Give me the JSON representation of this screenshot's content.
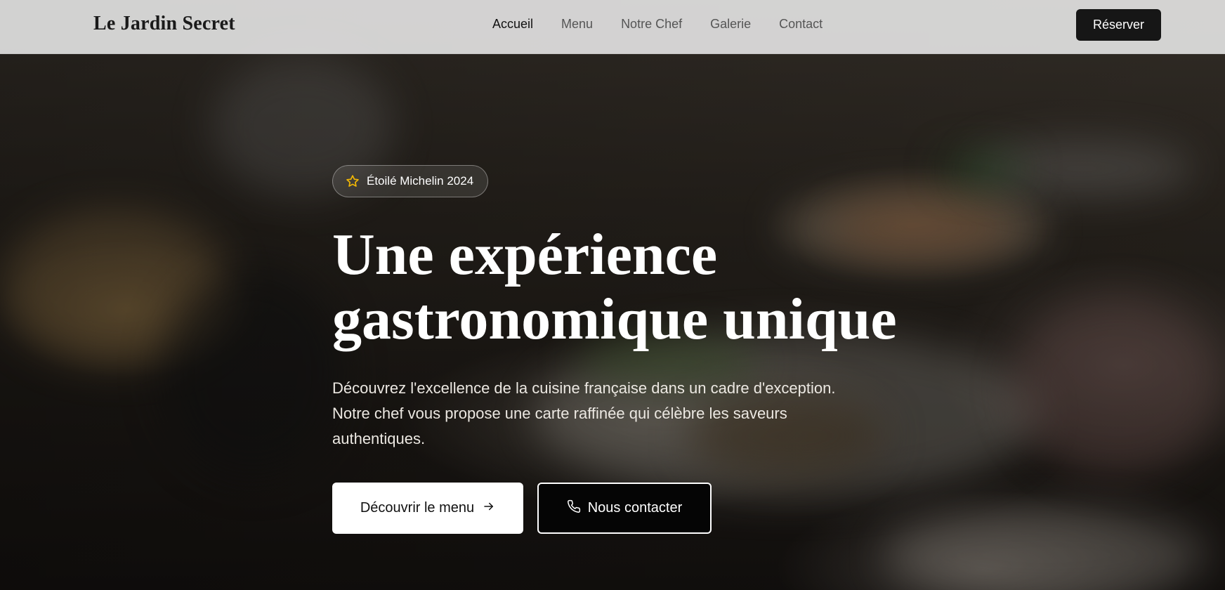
{
  "brand": {
    "name": "Le Jardin Secret"
  },
  "nav": {
    "items": [
      {
        "label": "Accueil",
        "active": true
      },
      {
        "label": "Menu",
        "active": false
      },
      {
        "label": "Notre Chef",
        "active": false
      },
      {
        "label": "Galerie",
        "active": false
      },
      {
        "label": "Contact",
        "active": false
      }
    ],
    "reserve_label": "Réserver"
  },
  "hero": {
    "badge": {
      "icon": "star-icon",
      "text": "Étoilé Michelin 2024"
    },
    "title_line1": "Une expérience",
    "title_line2": "gastronomique unique",
    "description": "Découvrez l'excellence de la cuisine française dans un cadre d'exception. Notre chef vous propose une carte raffinée qui célèbre les saveurs authentiques.",
    "primary_button": {
      "label": "Découvrir le menu",
      "icon": "arrow-right-icon"
    },
    "secondary_button": {
      "label": "Nous contacter",
      "icon": "phone-icon"
    }
  },
  "colors": {
    "accent": "#161616",
    "star": "#f2b705",
    "header_bg": "#ebebeb"
  }
}
